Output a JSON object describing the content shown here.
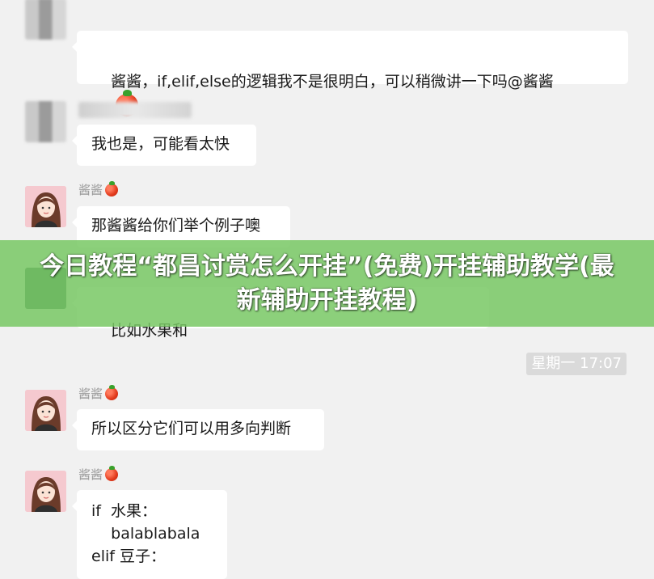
{
  "messages": [
    {
      "sender": "",
      "avatar": "blurred",
      "text": "酱酱，if,elif,else的逻辑我不是很明白，可以稍微讲一下吗@酱酱"
    },
    {
      "sender": "",
      "avatar": "blurred",
      "text": "我也是，可能看太快"
    },
    {
      "sender": "酱酱",
      "avatar": "girl",
      "text": "那酱酱给你们举个例子噢"
    },
    {
      "sender": "",
      "avatar": "green",
      "text": "比如水果和"
    },
    {
      "sender": "酱酱",
      "avatar": "girl",
      "text": "所以区分它们可以用多向判断"
    },
    {
      "sender": "酱酱",
      "avatar": "girl",
      "text": "if  水果：\n    balablabala\nelif 豆子："
    }
  ],
  "timestamp": "星期一 17:07",
  "banner": {
    "title": "今日教程“都昌讨赏怎么开挂”(免费)开挂辅助教学(最新辅助开挂教程)"
  },
  "icons": {
    "emoji": "tomato-icon"
  }
}
